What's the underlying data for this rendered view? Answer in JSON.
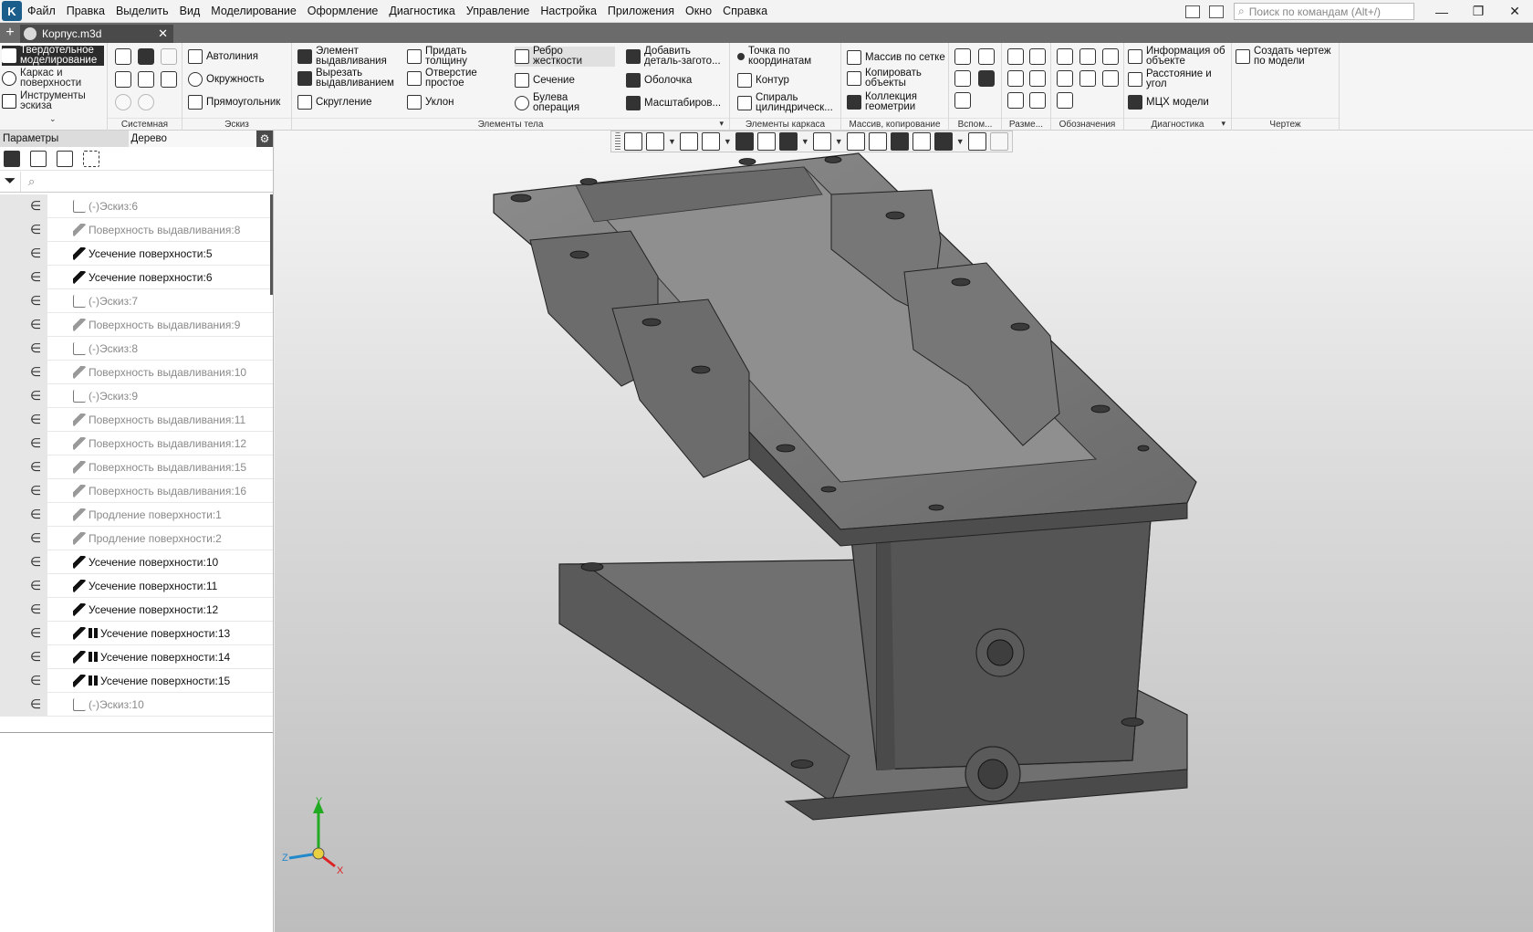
{
  "menubar": {
    "items": [
      "Файл",
      "Правка",
      "Выделить",
      "Вид",
      "Моделирование",
      "Оформление",
      "Диагностика",
      "Управление",
      "Настройка",
      "Приложения",
      "Окно",
      "Справка"
    ],
    "search_placeholder": "Поиск по командам (Alt+/)"
  },
  "tabs": {
    "add": "+",
    "document": "Корпус.m3d",
    "close": "✕"
  },
  "ribbon": {
    "modes": [
      "Твердотельное моделирование",
      "Каркас и поверхности",
      "Инструменты эскиза"
    ],
    "system_label": "Системная",
    "sketch": {
      "label": "Эскиз",
      "items": [
        "Автолиния",
        "Окружность",
        "Прямоугольник"
      ]
    },
    "body": {
      "label": "Элементы тела",
      "items": [
        "Элемент выдавливания",
        "Вырезать выдавливанием",
        "Скругление",
        "Придать толщину",
        "Отверстие простое",
        "Уклон",
        "Ребро жесткости",
        "Сечение",
        "Булева операция",
        "Добавить деталь-загото...",
        "Оболочка",
        "Масштабиров..."
      ]
    },
    "frame": {
      "label": "Элементы каркаса",
      "items": [
        "Точка по координатам",
        "Контур",
        "Спираль цилиндрическ..."
      ]
    },
    "array": {
      "label": "Массив, копирование",
      "items": [
        "Массив по сетке",
        "Копировать объекты",
        "Коллекция геометрии"
      ]
    },
    "aux_label": "Вспом...",
    "dims_label": "Разме...",
    "marks_label": "Обозначения",
    "diag": {
      "label": "Диагностика",
      "items": [
        "Информация об объекте",
        "Расстояние и угол",
        "МЦХ модели"
      ]
    },
    "drawing": {
      "label": "Чертеж",
      "items": [
        "Создать чертеж по модели"
      ]
    }
  },
  "panel": {
    "tab_params": "Параметры",
    "tab_tree": "Дерево",
    "search_glyph": "⌕",
    "tree": [
      {
        "label": "(-)Эскиз:6",
        "type": "sketch",
        "dim": true
      },
      {
        "label": "Поверхность выдавливания:8",
        "type": "ext",
        "dim": true
      },
      {
        "label": "Усечение поверхности:5",
        "type": "cut",
        "dim": false
      },
      {
        "label": "Усечение поверхности:6",
        "type": "cut",
        "dim": false
      },
      {
        "label": "(-)Эскиз:7",
        "type": "sketch",
        "dim": true
      },
      {
        "label": "Поверхность выдавливания:9",
        "type": "ext",
        "dim": true
      },
      {
        "label": "(-)Эскиз:8",
        "type": "sketch",
        "dim": true
      },
      {
        "label": "Поверхность выдавливания:10",
        "type": "ext",
        "dim": true
      },
      {
        "label": "(-)Эскиз:9",
        "type": "sketch",
        "dim": true
      },
      {
        "label": "Поверхность выдавливания:11",
        "type": "ext",
        "dim": true
      },
      {
        "label": "Поверхность выдавливания:12",
        "type": "ext",
        "dim": true
      },
      {
        "label": "Поверхность выдавливания:15",
        "type": "ext",
        "dim": true
      },
      {
        "label": "Поверхность выдавливания:16",
        "type": "ext",
        "dim": true
      },
      {
        "label": "Продление поверхности:1",
        "type": "ext",
        "dim": true
      },
      {
        "label": "Продление поверхности:2",
        "type": "ext",
        "dim": true
      },
      {
        "label": "Усечение поверхности:10",
        "type": "cut",
        "dim": false
      },
      {
        "label": "Усечение поверхности:11",
        "type": "cut",
        "dim": false
      },
      {
        "label": "Усечение поверхности:12",
        "type": "cut",
        "dim": false
      },
      {
        "label": "Усечение поверхности:13",
        "type": "cut-array",
        "dim": false
      },
      {
        "label": "Усечение поверхности:14",
        "type": "cut-array",
        "dim": false
      },
      {
        "label": "Усечение поверхности:15",
        "type": "cut-array",
        "dim": false
      },
      {
        "label": "(-)Эскиз:10",
        "type": "sketch",
        "dim": true
      }
    ]
  },
  "axes": {
    "x": "X",
    "y": "Y",
    "z": "Z"
  },
  "colors": {
    "model": "#5f5f5f",
    "model_dark": "#3c3c3c",
    "model_light": "#8a8a8a",
    "axis_x": "#d22",
    "axis_y": "#2a2",
    "axis_z": "#28c"
  }
}
